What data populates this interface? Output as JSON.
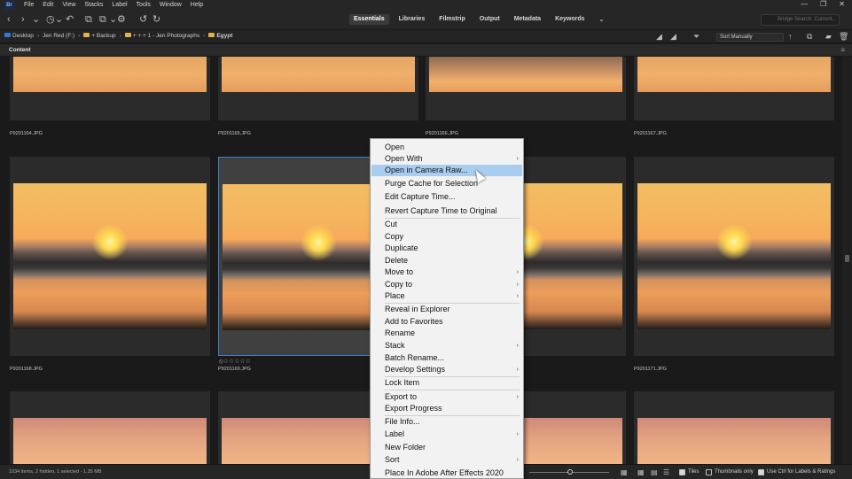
{
  "app": {
    "logo": "Br"
  },
  "menubar": {
    "items": [
      "File",
      "Edit",
      "View",
      "Stacks",
      "Label",
      "Tools",
      "Window",
      "Help"
    ]
  },
  "window_controls": {
    "minimize": "—",
    "restore": "❐",
    "close": "✕"
  },
  "toolbar": {
    "workspaces": [
      "Essentials",
      "Libraries",
      "Filmstrip",
      "Output",
      "Metadata",
      "Keywords"
    ],
    "active_workspace": "Essentials",
    "more": "⌄",
    "search_placeholder": "Bridge Search: Current..."
  },
  "pathbar": {
    "crumbs": [
      "Desktop",
      "Jen Red (F:)",
      "+ Backup",
      "+ + + 1 - Jen Photographs",
      "Egypt"
    ],
    "sort_label": "Sort Manually",
    "sort_arrow": "↑"
  },
  "panel": {
    "title": "Content",
    "menu": "≡"
  },
  "grid": {
    "rows": [
      [
        "P9201164.JPG",
        "P9201165.JPG",
        "P9201166.JPG",
        "P9201167.JPG"
      ],
      [
        "P9201168.JPG",
        "P9201169.JPG",
        "",
        "P9201171.JPG"
      ]
    ],
    "selected": "P9201169.JPG",
    "rating_stars": "⦸☆☆☆☆☆"
  },
  "status": {
    "text": "1034 items, 2 hidden, 1 selected - 1.35 MB",
    "tiles_label": "Tiles",
    "thumbnails_only_label": "Thumbnails only",
    "ctrl_label": "Use Ctrl for Labels & Ratings",
    "zoom_level": 0.51
  },
  "context_menu": {
    "items": [
      {
        "label": "Open",
        "sub": false
      },
      {
        "label": "Open With",
        "sub": true
      },
      {
        "label": "Open in Camera Raw...",
        "sub": false,
        "highlight": true
      },
      {
        "label": "Purge Cache for Selection",
        "sub": false
      },
      {
        "label": "Edit Capture Time...",
        "sub": false
      },
      {
        "label": "Revert Capture Time to Original",
        "sub": false
      },
      {
        "label": "Cut",
        "sub": false
      },
      {
        "label": "Copy",
        "sub": false
      },
      {
        "label": "Duplicate",
        "sub": false
      },
      {
        "label": "Delete",
        "sub": false
      },
      {
        "label": "Move to",
        "sub": true
      },
      {
        "label": "Copy to",
        "sub": true
      },
      {
        "label": "Place",
        "sub": true
      },
      {
        "label": "Reveal in Explorer",
        "sub": false
      },
      {
        "label": "Add to Favorites",
        "sub": false
      },
      {
        "label": "Rename",
        "sub": false
      },
      {
        "label": "Stack",
        "sub": true
      },
      {
        "label": "Batch Rename...",
        "sub": false
      },
      {
        "label": "Develop Settings",
        "sub": true
      },
      {
        "label": "Lock Item",
        "sub": false
      },
      {
        "label": "Export to",
        "sub": true
      },
      {
        "label": "Export Progress",
        "sub": false
      },
      {
        "label": "File Info...",
        "sub": false
      },
      {
        "label": "Label",
        "sub": true
      },
      {
        "label": "New Folder",
        "sub": false
      },
      {
        "label": "Sort",
        "sub": true
      },
      {
        "label": "Place In Adobe After Effects 2020",
        "sub": false
      }
    ],
    "submenu_arrow": "›"
  },
  "icons": {
    "back": "‹",
    "forward": "›",
    "down": "⌄",
    "history": "◷",
    "boomerang": "↶",
    "camera": "⧉",
    "copy": "⧉",
    "refine": "⚙",
    "rotate_left": "↺",
    "rotate_right": "↻",
    "search": "⌕",
    "quality": "◢",
    "filter": "⏷",
    "new_folder": "▰",
    "trash": "🗑",
    "grid": "▦",
    "list": "☰",
    "details": "▤"
  },
  "colors": {
    "accent": "#3d7ec9",
    "highlight": "#a9cdee",
    "background": "#1e1e1e"
  }
}
